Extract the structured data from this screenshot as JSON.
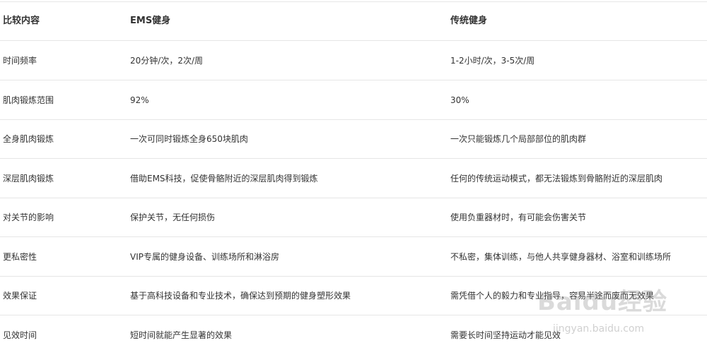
{
  "table": {
    "headers": [
      "比较内容",
      "EMS健身",
      "传统健身"
    ],
    "rows": [
      [
        "时间频率",
        "20分钟/次，2次/周",
        "1-2小时/次，3-5次/周"
      ],
      [
        "肌肉锻炼范围",
        "92%",
        "30%"
      ],
      [
        "全身肌肉锻炼",
        "一次可同时锻炼全身650块肌肉",
        "一次只能锻炼几个局部部位的肌肉群"
      ],
      [
        "深层肌肉锻炼",
        "借助EMS科技，促使骨骼附近的深层肌肉得到锻炼",
        "任何的传统运动模式，都无法锻炼到骨骼附近的深层肌肉"
      ],
      [
        "对关节的影响",
        "保护关节，无任何损伤",
        "使用负重器材时，有可能会伤害关节"
      ],
      [
        "更私密性",
        "VIP专属的健身设备、训练场所和淋浴房",
        "不私密，集体训练，与他人共享健身器材、浴室和训练场所"
      ],
      [
        "效果保证",
        "基于高科技设备和专业技术，确保达到预期的健身塑形效果",
        "需凭借个人的毅力和专业指导，容易半途而废而无效果"
      ],
      [
        "见效时间",
        "短时间就能产生显著的效果",
        "需要长时间坚持运动才能见效"
      ]
    ]
  },
  "watermark": {
    "logo": "Baidu经验",
    "url": "jingyan.baidu.com"
  }
}
